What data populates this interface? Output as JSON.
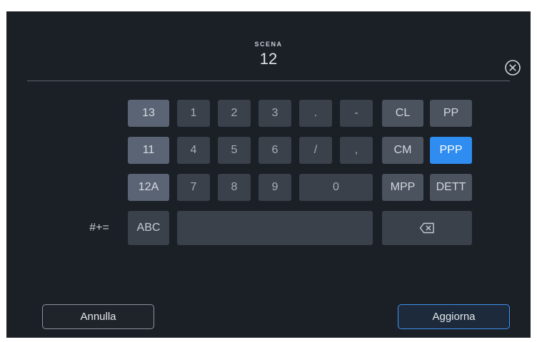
{
  "field": {
    "title": "SCENA",
    "value": "12"
  },
  "keyboard": {
    "history": [
      "13",
      "11",
      "12A"
    ],
    "digits_row1": [
      "1",
      "2",
      "3",
      ".",
      "-"
    ],
    "digits_row2": [
      "4",
      "5",
      "6",
      "/",
      ","
    ],
    "digits_row3": [
      "7",
      "8",
      "9",
      "0"
    ],
    "tags_row1": [
      "CL",
      "PP"
    ],
    "tags_row2": [
      "CM",
      "PPP"
    ],
    "tags_row3": [
      "MPP",
      "DETT"
    ],
    "symbols_label": "#+=",
    "abc_label": "ABC",
    "selected_tag": "PPP"
  },
  "footer": {
    "cancel_label": "Annulla",
    "update_label": "Aggiorna"
  },
  "colors": {
    "background": "#1b1f26",
    "accent": "#2f8cf0"
  },
  "icons": {
    "clear": "circle-x-icon",
    "backspace": "backspace-icon"
  }
}
